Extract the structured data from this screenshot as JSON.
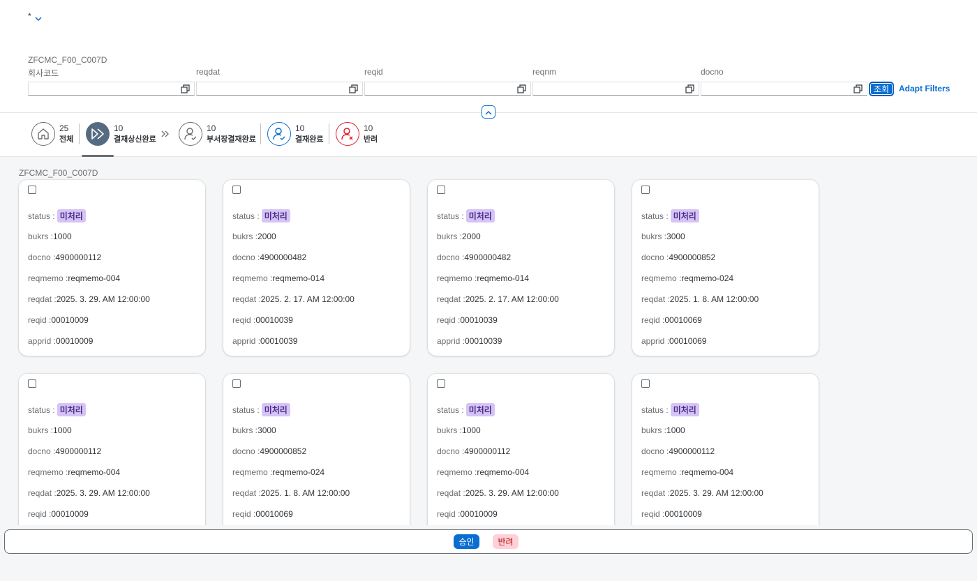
{
  "variant": {
    "name": "*"
  },
  "filterbar": {
    "title": "ZFCMC_F00_C007D",
    "fields": [
      {
        "label": "회사코드",
        "value": ""
      },
      {
        "label": "reqdat",
        "value": ""
      },
      {
        "label": "reqid",
        "value": ""
      },
      {
        "label": "reqnm",
        "value": ""
      },
      {
        "label": "docno",
        "value": ""
      }
    ],
    "go_label": "조회",
    "adapt_label": "Adapt Filters"
  },
  "tabs": [
    {
      "count": "25",
      "label": "전체"
    },
    {
      "count": "10",
      "label": "결재상신완료"
    },
    {
      "count": "10",
      "label": "부서장결재완료"
    },
    {
      "count": "10",
      "label": "결재완료"
    },
    {
      "count": "10",
      "label": "반려"
    }
  ],
  "content": {
    "title": "ZFCMC_F00_C007D",
    "labels": {
      "status": "status :",
      "bukrs": "bukrs :",
      "docno": "docno :",
      "reqmemo": "reqmemo :",
      "reqdat": "reqdat :",
      "reqid": "reqid :",
      "apprid": "apprid :"
    },
    "cards": [
      {
        "status": "미처리",
        "bukrs": "1000",
        "docno": "4900000112",
        "reqmemo": "reqmemo-004",
        "reqdat": "2025. 3. 29. AM 12:00:00",
        "reqid": "00010009",
        "apprid": "00010009"
      },
      {
        "status": "미처리",
        "bukrs": "2000",
        "docno": "4900000482",
        "reqmemo": "reqmemo-014",
        "reqdat": "2025. 2. 17. AM 12:00:00",
        "reqid": "00010039",
        "apprid": "00010039"
      },
      {
        "status": "미처리",
        "bukrs": "2000",
        "docno": "4900000482",
        "reqmemo": "reqmemo-014",
        "reqdat": "2025. 2. 17. AM 12:00:00",
        "reqid": "00010039",
        "apprid": "00010039"
      },
      {
        "status": "미처리",
        "bukrs": "3000",
        "docno": "4900000852",
        "reqmemo": "reqmemo-024",
        "reqdat": "2025. 1. 8. AM 12:00:00",
        "reqid": "00010069",
        "apprid": "00010069"
      },
      {
        "status": "미처리",
        "bukrs": "1000",
        "docno": "4900000112",
        "reqmemo": "reqmemo-004",
        "reqdat": "2025. 3. 29. AM 12:00:00",
        "reqid": "00010009"
      },
      {
        "status": "미처리",
        "bukrs": "3000",
        "docno": "4900000852",
        "reqmemo": "reqmemo-024",
        "reqdat": "2025. 1. 8. AM 12:00:00",
        "reqid": "00010069"
      },
      {
        "status": "미처리",
        "bukrs": "1000",
        "docno": "4900000112",
        "reqmemo": "reqmemo-004",
        "reqdat": "2025. 3. 29. AM 12:00:00",
        "reqid": "00010009"
      },
      {
        "status": "미처리",
        "bukrs": "1000",
        "docno": "4900000112",
        "reqmemo": "reqmemo-004",
        "reqdat": "2025. 3. 29. AM 12:00:00",
        "reqid": "00010009"
      }
    ]
  },
  "footer": {
    "approve_label": "승인",
    "reject_label": "반려"
  },
  "colors": {
    "accent": "#0a6ed1",
    "status_tag_bg": "#d5c4f5",
    "reject_red": "#e11d2b",
    "tab_active_bg": "#556b82"
  },
  "icons": [
    "chevron-down-icon",
    "value-help-icon",
    "home-icon",
    "forward-icon",
    "user-check-icon",
    "user-cancel-icon",
    "double-chevron-right-icon",
    "chevron-up-icon"
  ]
}
